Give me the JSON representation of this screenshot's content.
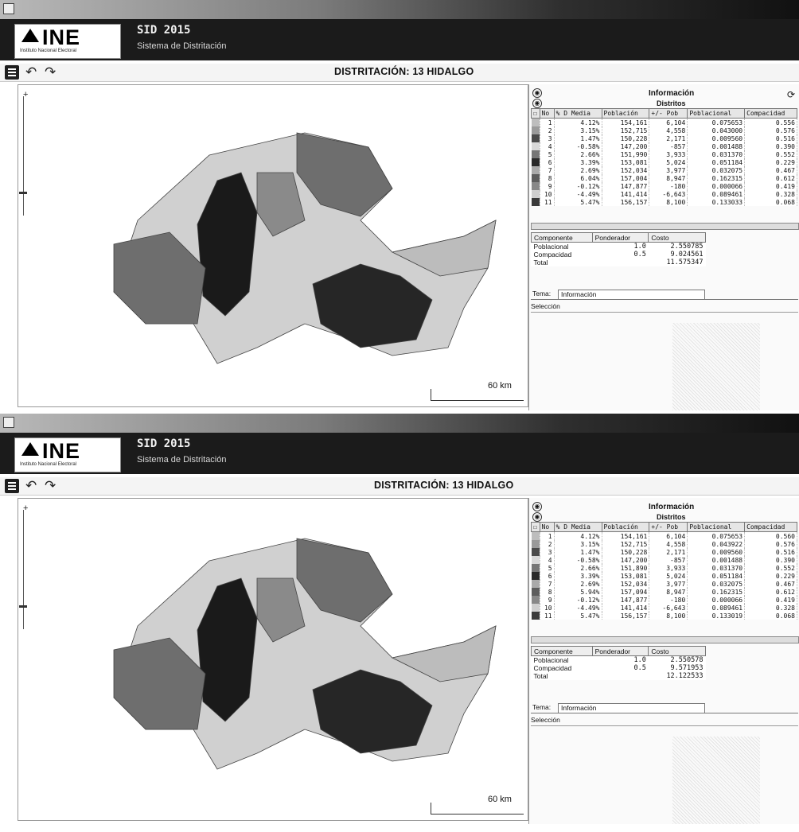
{
  "app": {
    "logo_text": "INE",
    "logo_subtitle": "Instituto Nacional Electoral",
    "title": "SID 2015",
    "subtitle": "Sistema de Distritación",
    "distritacion_title": "DISTRITACIÓN: 13 HIDALGO"
  },
  "icons": {
    "menu": "menu-icon",
    "undo": "undo-icon",
    "redo": "redo-icon",
    "refresh": "refresh-icon",
    "collapse": "collapse-circle-icon"
  },
  "colors": {
    "header_bg": "#1b1b1b",
    "map_dark": "#1a1a1a",
    "map_mid": "#6e6e6e",
    "map_light": "#d0d0d0"
  },
  "map": {
    "zoom_plus": "+",
    "scale_label": "60 km"
  },
  "panel": {
    "info_title": "Información",
    "info_subtitle": "Distritos",
    "columns": [
      "No",
      "% D Media",
      "Población",
      "+/- Pob",
      "Poblacional",
      "Compacidad"
    ],
    "composite_headers": [
      "Componente",
      "Ponderador",
      "Costo"
    ],
    "tab_label": "Tema:",
    "tab_name": "Información",
    "selection_label": "Selección"
  },
  "screens": [
    {
      "districts": [
        {
          "no": "1",
          "dmedia": "4.12%",
          "pob": "154,161",
          "dpob": "6,104",
          "poblacional": "0.075653",
          "compacidad": "0.556"
        },
        {
          "no": "2",
          "dmedia": "3.15%",
          "pob": "152,715",
          "dpob": "4,558",
          "poblacional": "0.043000",
          "compacidad": "0.576"
        },
        {
          "no": "3",
          "dmedia": "1.47%",
          "pob": "150,228",
          "dpob": "2,171",
          "poblacional": "0.009560",
          "compacidad": "0.516"
        },
        {
          "no": "4",
          "dmedia": "-0.58%",
          "pob": "147,200",
          "dpob": "-857",
          "poblacional": "0.001488",
          "compacidad": "0.390"
        },
        {
          "no": "5",
          "dmedia": "2.66%",
          "pob": "151,990",
          "dpob": "3,933",
          "poblacional": "0.031370",
          "compacidad": "0.552"
        },
        {
          "no": "6",
          "dmedia": "3.39%",
          "pob": "153,081",
          "dpob": "5,024",
          "poblacional": "0.051184",
          "compacidad": "0.229"
        },
        {
          "no": "7",
          "dmedia": "2.69%",
          "pob": "152,034",
          "dpob": "3,977",
          "poblacional": "0.032075",
          "compacidad": "0.467"
        },
        {
          "no": "8",
          "dmedia": "6.04%",
          "pob": "157,004",
          "dpob": "8,947",
          "poblacional": "0.162315",
          "compacidad": "0.612"
        },
        {
          "no": "9",
          "dmedia": "-0.12%",
          "pob": "147,877",
          "dpob": "-180",
          "poblacional": "0.000066",
          "compacidad": "0.419"
        },
        {
          "no": "10",
          "dmedia": "-4.49%",
          "pob": "141,414",
          "dpob": "-6,643",
          "poblacional": "0.089461",
          "compacidad": "0.328"
        },
        {
          "no": "11",
          "dmedia": "5.47%",
          "pob": "156,157",
          "dpob": "8,100",
          "poblacional": "0.133033",
          "compacidad": "0.068"
        }
      ],
      "composite": [
        {
          "comp": "Poblacional",
          "pond": "1.0",
          "costo": "2.550785"
        },
        {
          "comp": "Compacidad",
          "pond": "0.5",
          "costo": "9.024561"
        },
        {
          "comp": "Total",
          "pond": "",
          "costo": "11.575347"
        }
      ]
    },
    {
      "districts": [
        {
          "no": "1",
          "dmedia": "4.12%",
          "pob": "154,161",
          "dpob": "6,104",
          "poblacional": "0.075653",
          "compacidad": "0.560"
        },
        {
          "no": "2",
          "dmedia": "3.15%",
          "pob": "152,715",
          "dpob": "4,558",
          "poblacional": "0.043922",
          "compacidad": "0.576"
        },
        {
          "no": "3",
          "dmedia": "1.47%",
          "pob": "150,228",
          "dpob": "2,171",
          "poblacional": "0.009560",
          "compacidad": "0.516"
        },
        {
          "no": "4",
          "dmedia": "-0.58%",
          "pob": "147,200",
          "dpob": "-857",
          "poblacional": "0.001488",
          "compacidad": "0.390"
        },
        {
          "no": "5",
          "dmedia": "2.66%",
          "pob": "151,890",
          "dpob": "3,933",
          "poblacional": "0.031370",
          "compacidad": "0.552"
        },
        {
          "no": "6",
          "dmedia": "3.39%",
          "pob": "153,081",
          "dpob": "5,024",
          "poblacional": "0.051184",
          "compacidad": "0.229"
        },
        {
          "no": "7",
          "dmedia": "2.69%",
          "pob": "152,034",
          "dpob": "3,977",
          "poblacional": "0.032075",
          "compacidad": "0.467"
        },
        {
          "no": "8",
          "dmedia": "5.94%",
          "pob": "157,094",
          "dpob": "8,947",
          "poblacional": "0.162315",
          "compacidad": "0.612"
        },
        {
          "no": "9",
          "dmedia": "-0.12%",
          "pob": "147,877",
          "dpob": "-180",
          "poblacional": "0.000066",
          "compacidad": "0.419"
        },
        {
          "no": "10",
          "dmedia": "-4.49%",
          "pob": "141,414",
          "dpob": "-6,643",
          "poblacional": "0.089461",
          "compacidad": "0.328"
        },
        {
          "no": "11",
          "dmedia": "5.47%",
          "pob": "156,157",
          "dpob": "8,100",
          "poblacional": "0.133019",
          "compacidad": "0.068"
        }
      ],
      "composite": [
        {
          "comp": "Poblacional",
          "pond": "1.0",
          "costo": "2.550578"
        },
        {
          "comp": "Compacidad",
          "pond": "0.5",
          "costo": "9.571953"
        },
        {
          "comp": "Total",
          "pond": "",
          "costo": "12.122533"
        }
      ]
    }
  ]
}
